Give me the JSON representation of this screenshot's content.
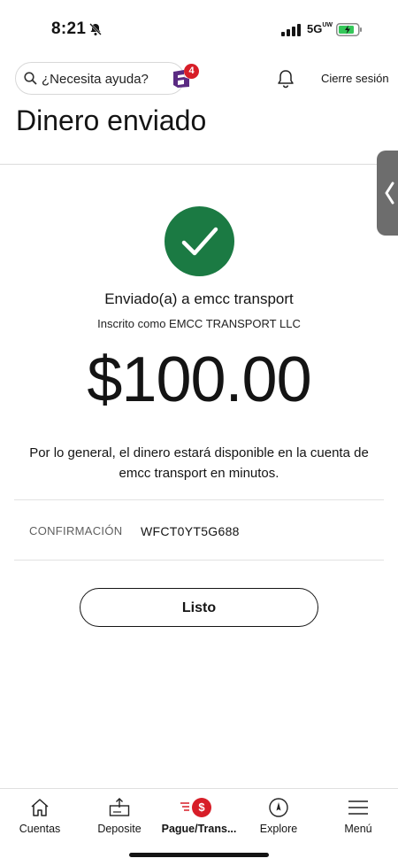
{
  "status_bar": {
    "time": "8:21",
    "network": "5G",
    "network_sub": "UW"
  },
  "header": {
    "search_placeholder": "¿Necesita ayuda?",
    "fargo_badge": "4",
    "signout_label": "Cierre sesión"
  },
  "page": {
    "title": "Dinero enviado"
  },
  "confirmation": {
    "sent_to": "Enviado(a) a emcc transport",
    "enrolled_as": "Inscrito como EMCC TRANSPORT LLC",
    "amount": "$100.00",
    "availability": "Por lo general, el dinero estará disponible en la cuenta de emcc transport en minutos.",
    "conf_label": "CONFIRMACIÓN",
    "conf_value": "WFCT0YT5G688",
    "done_label": "Listo"
  },
  "nav": {
    "items": [
      {
        "label": "Cuentas",
        "icon": "home-icon"
      },
      {
        "label": "Deposite",
        "icon": "deposit-icon"
      },
      {
        "label": "Pague/Trans...",
        "icon": "pay-transfer-icon"
      },
      {
        "label": "Explore",
        "icon": "compass-icon"
      },
      {
        "label": "Menú",
        "icon": "menu-icon"
      }
    ],
    "active_index": 2
  },
  "colors": {
    "success_green": "#1b7a43",
    "brand_red": "#d71e28",
    "fargo_purple": "#5a2a82"
  }
}
